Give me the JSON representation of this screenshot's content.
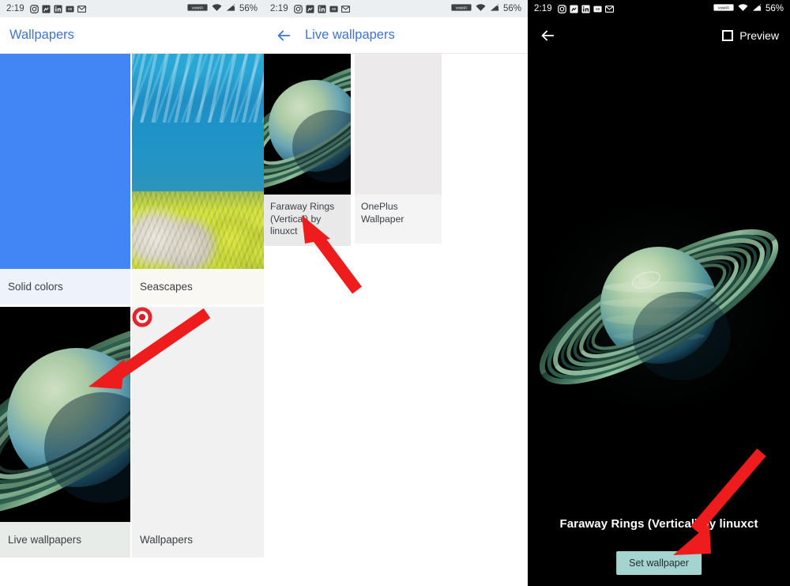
{
  "status_bar": {
    "time": "2:19",
    "battery": "56%",
    "notification_icons": [
      "instagram-icon",
      "facebook-messenger-icon",
      "linkedin-icon",
      "sms-icon",
      "gmail-icon"
    ],
    "right_icons": [
      "vowifi-icon",
      "wifi-icon",
      "signal-icon"
    ],
    "vowifi_label": "VoWiFi"
  },
  "panel1": {
    "title": "Wallpapers",
    "tiles": [
      {
        "label": "Solid colors",
        "art": "solid-blue"
      },
      {
        "label": "Seascapes",
        "art": "seascape"
      },
      {
        "label": "Live wallpapers",
        "art": "saturn-crop"
      },
      {
        "label": "Wallpapers",
        "art": "target-icon"
      }
    ]
  },
  "panel2": {
    "title": "Live wallpapers",
    "back_icon": "back-arrow-icon",
    "tiles": [
      {
        "label": "Faraway Rings (Vertical) by linuxct",
        "art": "saturn-crop",
        "selected": true
      },
      {
        "label": "OnePlus Wallpaper",
        "art": "blank",
        "selected": false
      }
    ]
  },
  "panel3": {
    "back_icon": "back-arrow-icon",
    "preview_label": "Preview",
    "preview_checked": false,
    "wallpaper_title": "Faraway Rings (Vertical) by linuxct",
    "set_wallpaper_label": "Set wallpaper",
    "art": "saturn-full"
  },
  "annotations": {
    "arrow_count": 3,
    "color": "#ee1c1c"
  },
  "colors": {
    "accent_blue": "#3f73d4",
    "solid_tile": "#4285f4",
    "button_bg": "#a5d3cf",
    "status_bar_light": "#eceff1",
    "arrow_red": "#ee1c1c"
  }
}
